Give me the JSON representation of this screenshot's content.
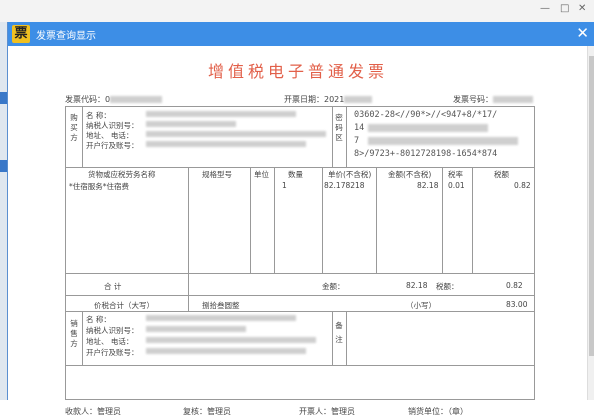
{
  "window": {
    "title": "发票查询显示",
    "close_glyph": "✕",
    "icon_glyph": "票"
  },
  "background": {
    "ctrl_min": "—",
    "ctrl_max": "□",
    "ctrl_close": "✕"
  },
  "invoice": {
    "title": "增值税电子普通发票",
    "code_label": "发票代码：",
    "code_value": "0",
    "date_label": "开票日期：",
    "date_value": "2021",
    "number_label": "发票号码：",
    "buyer_label": [
      "购",
      "买",
      "方"
    ],
    "name_label": "名        称：",
    "taxid_label": "纳税人识别号：",
    "addr_label": "地址、 电话：",
    "bank_label": "开户行及账号：",
    "pw_label": [
      "密",
      "码",
      "区"
    ],
    "pw_lines": [
      "03602-28<//90*>//<947+8/*17/",
      "14",
      "7",
      "8>/9723+-8012728198-1654*874"
    ],
    "col_goods": "货物或应税劳务名称",
    "col_spec": "规格型号",
    "col_unit": "单位",
    "col_qty": "数量",
    "col_price": "单价(不含税)",
    "col_amount": "金额(不含税)",
    "col_rate": "税率",
    "col_tax": "税额",
    "item_name": "*住宿服务*住宿费",
    "item_qty": "1",
    "item_price": "82.178218",
    "item_amount": "82.18",
    "item_rate": "0.01",
    "item_tax": "0.82",
    "total_label": "合        计",
    "amount_label": "金额：",
    "total_amount": "82.18",
    "tax_label": "税额：",
    "total_tax": "0.82",
    "grand_label": "价税合计（大写）",
    "grand_words": "捌拾叁圆整",
    "small_label": "（小写）",
    "grand_small": "83.00",
    "seller_label": [
      "销",
      "售",
      "方"
    ],
    "remark_label": [
      "备",
      "注"
    ],
    "payee": "收款人：管理员",
    "reviewer": "复核：管理员",
    "issuer": "开票人：管理员",
    "seller_stamp": "销货单位：（章）"
  }
}
